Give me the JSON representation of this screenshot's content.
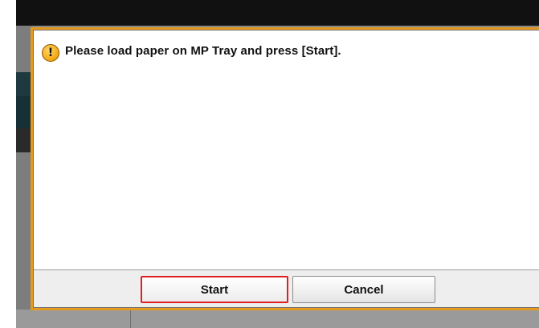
{
  "dialog": {
    "message": "Please load paper on MP Tray and press [Start].",
    "icon": "warning-icon",
    "border_color": "#e59a1e"
  },
  "buttons": {
    "start_label": "Start",
    "cancel_label": "Cancel",
    "highlight_color": "#e02020"
  }
}
